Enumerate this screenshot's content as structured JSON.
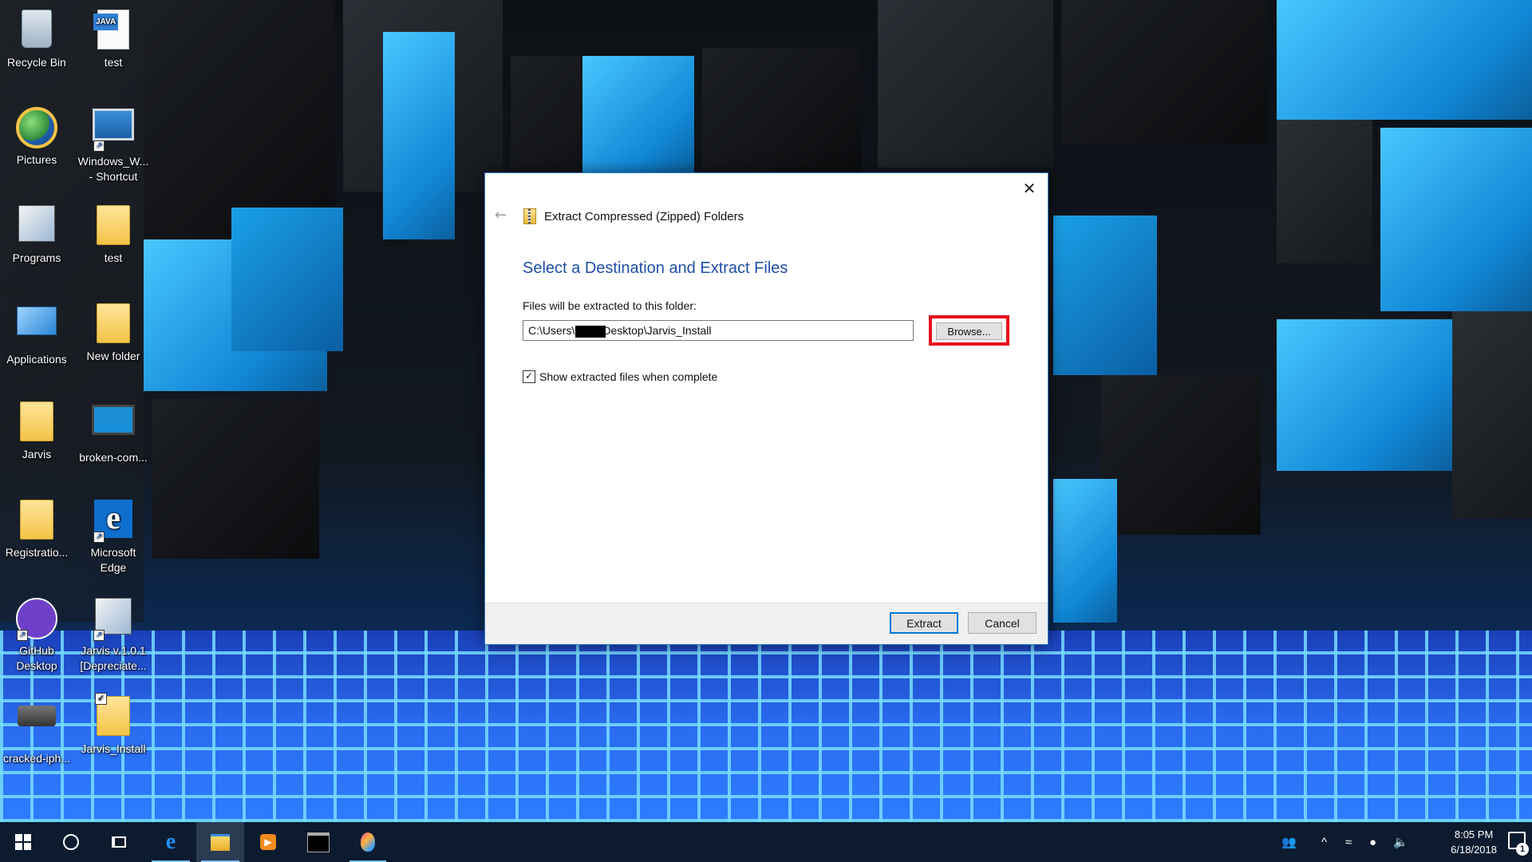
{
  "desktop": {
    "icons": [
      {
        "label": "Recycle Bin"
      },
      {
        "label": "test",
        "badge": "JAVA"
      },
      {
        "label": "Pictures"
      },
      {
        "label": "Windows_W... - Shortcut"
      },
      {
        "label": "Programs"
      },
      {
        "label": "test"
      },
      {
        "label": "Applications"
      },
      {
        "label": "New folder"
      },
      {
        "label": "Jarvis"
      },
      {
        "label": "broken-com..."
      },
      {
        "label": "Registratio..."
      },
      {
        "label": "Microsoft Edge"
      },
      {
        "label": "GitHub Desktop"
      },
      {
        "label": "Jarvis v.1.0.1 [Depreciate..."
      },
      {
        "label": "cracked-iph..."
      },
      {
        "label": "Jarvis_Install"
      }
    ]
  },
  "dialog": {
    "window_title": "Extract Compressed (Zipped) Folders",
    "heading": "Select a Destination and Extract Files",
    "dest_label": "Files will be extracted to this folder:",
    "dest_value": "C:\\Users\\        \\Desktop\\Jarvis_Install",
    "browse_label": "Browse...",
    "show_files_label": "Show extracted files when complete",
    "show_files_checked": true,
    "check_glyph": "✓",
    "close_glyph": "✕",
    "back_glyph": "←",
    "extract_label": "Extract",
    "cancel_label": "Cancel",
    "highlight_color": "#e8101c",
    "heading_color": "#1f4fa8"
  },
  "taskbar": {
    "apps": [
      {
        "name": "start-button"
      },
      {
        "name": "cortana-search"
      },
      {
        "name": "task-view"
      },
      {
        "name": "microsoft-edge"
      },
      {
        "name": "file-explorer"
      },
      {
        "name": "media-player"
      },
      {
        "name": "command-prompt"
      },
      {
        "name": "paint-3d"
      }
    ],
    "clock_time": "8:05 PM",
    "clock_date": "6/18/2018",
    "notification_count": "1",
    "color": "#0c1b2e"
  }
}
